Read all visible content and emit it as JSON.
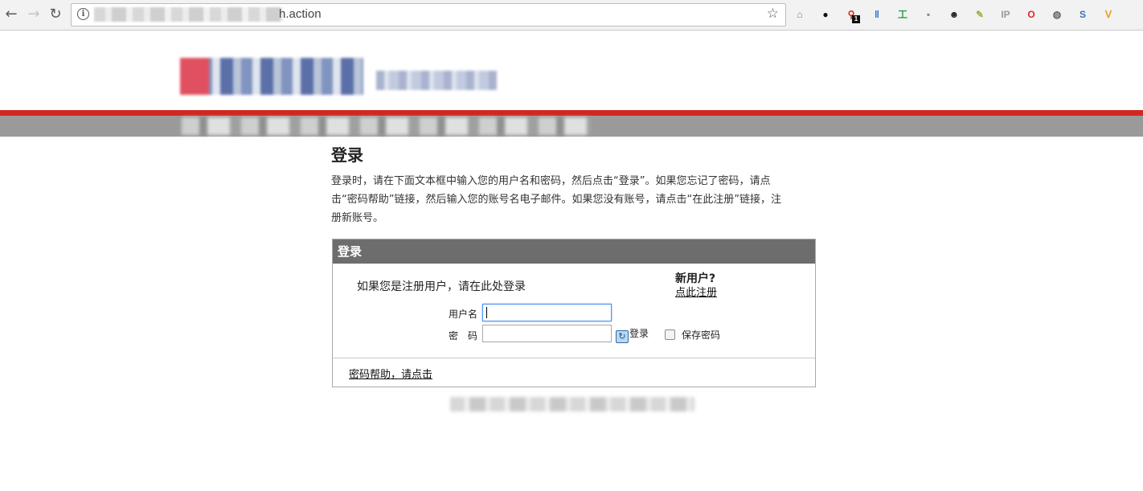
{
  "browser": {
    "url_suffix": "h.action",
    "extensions": [
      {
        "icon": "home-colorful-icon",
        "glyph": "⌂",
        "color": "#e0622a"
      },
      {
        "icon": "circle-record-icon",
        "glyph": "●",
        "color": "#111111"
      },
      {
        "icon": "link-badge-icon",
        "glyph": "⚲",
        "color": "#d0281e",
        "badge": "1"
      },
      {
        "icon": "double-bar-icon",
        "glyph": "‖",
        "color": "#2a6ad4"
      },
      {
        "icon": "develop-tool-icon",
        "glyph": "工",
        "color": "#2aa04a"
      },
      {
        "icon": "hex-icon",
        "glyph": "▪",
        "color": "#888888"
      },
      {
        "icon": "mask-icon",
        "glyph": "☻",
        "color": "#222222"
      },
      {
        "icon": "palette-icon",
        "glyph": "✎",
        "color": "#9ab63c"
      },
      {
        "icon": "ip-icon",
        "glyph": "IP",
        "color": "#9a9a9a"
      },
      {
        "icon": "opera-icon",
        "glyph": "O",
        "color": "#e0242a"
      },
      {
        "icon": "refresh-circle-icon",
        "glyph": "◍",
        "color": "#666666"
      },
      {
        "icon": "s-icon",
        "glyph": "S",
        "color": "#3a72b8"
      },
      {
        "icon": "fox-icon",
        "glyph": "ᐯ",
        "color": "#e8a020"
      }
    ]
  },
  "page": {
    "title": "登录",
    "intro": "登录时，请在下面文本框中输入您的用户名和密码，然后点击“登录”。如果您忘记了密码，请点击“密码帮助”链接，然后输入您的账号名电子邮件。如果您没有账号，请点击“在此注册”链接，注册新账号。"
  },
  "login_panel": {
    "header": "登录",
    "registered_note": "如果您是注册用户，请在此处登录",
    "new_user_title": "新用户?",
    "register_link": "点此注册",
    "username_label": "用户名",
    "password_label": "密　码",
    "username_value": "",
    "password_value": "",
    "login_button": "登录",
    "remember_label": "保存密码",
    "remember_checked": false,
    "help_link": "密码帮助，请点击"
  }
}
